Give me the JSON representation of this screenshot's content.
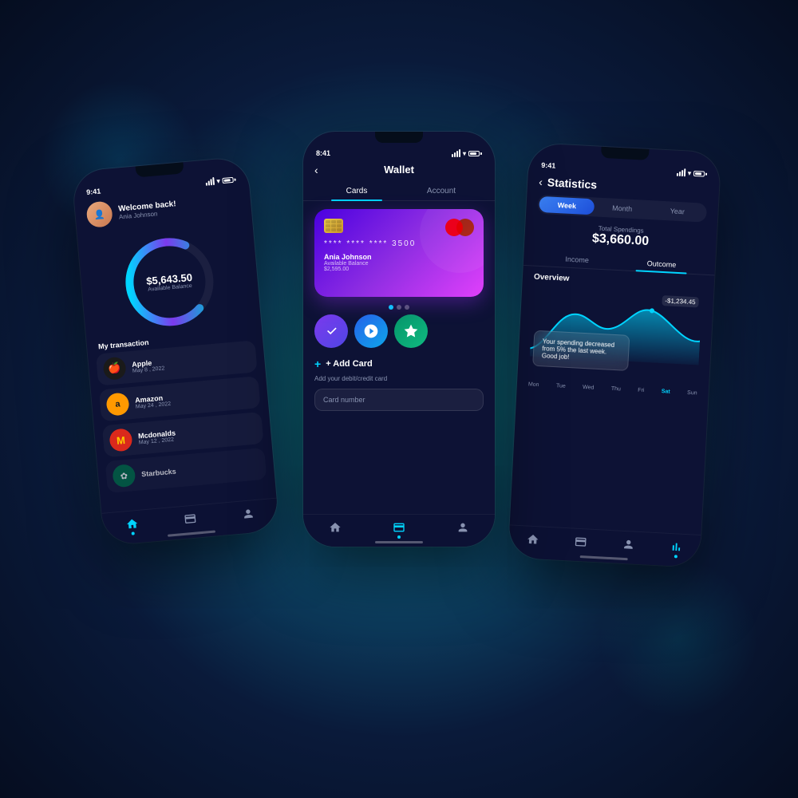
{
  "background": {
    "gradient": "radial teal to dark navy"
  },
  "phone_left": {
    "status_bar": {
      "time": "9:41",
      "signal": "▲▲▲",
      "wifi": "wifi",
      "battery": "battery"
    },
    "header": {
      "welcome": "Welcome back!",
      "name": "Ania Johnson"
    },
    "balance": {
      "amount": "$5,643.50",
      "label": "Available Balance"
    },
    "section_title": "My transaction",
    "transactions": [
      {
        "name": "Apple",
        "date": "May 8 , 2022",
        "icon": "🍎",
        "bg": "apple"
      },
      {
        "name": "Amazon",
        "date": "May 24 , 2022",
        "icon": "A",
        "bg": "amazon"
      },
      {
        "name": "Mcdonalds",
        "date": "May 12 , 2022",
        "icon": "M",
        "bg": "mcd"
      },
      {
        "name": "Starbucks",
        "date": "",
        "icon": "★",
        "bg": "starbucks"
      }
    ],
    "nav": {
      "items": [
        "home",
        "card",
        "user"
      ]
    }
  },
  "phone_center": {
    "status_bar": {
      "time": "8:41"
    },
    "title": "Wallet",
    "tabs": [
      "Cards",
      "Account"
    ],
    "card": {
      "number": "**** **** **** 3500",
      "name": "Ania Johnson",
      "balance_label": "Available Balance",
      "balance": "$2,595.00"
    },
    "add_card": {
      "title": "+ Add Card",
      "subtitle": "Add your debit/credit card",
      "input_placeholder": "Card number"
    },
    "nav": {
      "items": [
        "home",
        "card",
        "user"
      ]
    }
  },
  "phone_right": {
    "status_bar": {
      "time": "9:41"
    },
    "title": "Statistics",
    "time_tabs": [
      "Week",
      "Month",
      "Year"
    ],
    "active_time_tab": "Week",
    "total_spendings_label": "Total Spendings",
    "total_amount": "$3,660.00",
    "io_tabs": [
      "Income",
      "Outcome"
    ],
    "active_io_tab": "Outcome",
    "overview_label": "Overview",
    "chart_value": "-$1,234.45",
    "chart_tooltip": "Your spending decreased from 5% the last week. Good job!",
    "days": [
      "Mon",
      "Tue",
      "Wed",
      "Thu",
      "Fri",
      "Sat",
      "Sun"
    ],
    "active_day": "Sat",
    "nav": {
      "items": [
        "home",
        "card",
        "user",
        "stats"
      ]
    }
  }
}
